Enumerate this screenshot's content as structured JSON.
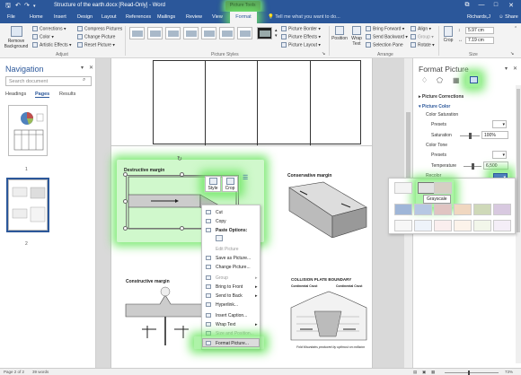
{
  "window": {
    "title": "Structure of the earth.docx [Read-Only] - Word",
    "context_group": "Picture Tools",
    "qa_icons": [
      "save-icon",
      "undo-icon",
      "redo-icon"
    ],
    "controls": [
      "restore-icon",
      "minimize-icon",
      "maximize-icon",
      "close-icon"
    ],
    "restore_glyph": "⧉",
    "min_glyph": "—",
    "max_glyph": "□",
    "close_glyph": "✕"
  },
  "tabs": [
    "File",
    "Home",
    "Insert",
    "Design",
    "Layout",
    "References",
    "Mailings",
    "Review",
    "View",
    "Format"
  ],
  "tell_me": "Tell me what you want to do...",
  "user": "Richards,J",
  "share": "Share",
  "ribbon": {
    "remove_background": "Remove Background",
    "corrections": "Corrections",
    "color": "Color",
    "artistic_effects": "Artistic Effects",
    "compress_pictures": "Compress Pictures",
    "change_picture": "Change Picture",
    "reset_picture": "Reset Picture",
    "group_adjust": "Adjust",
    "group_picture_styles": "Picture Styles",
    "picture_border": "Picture Border",
    "picture_effects": "Picture Effects",
    "picture_layout": "Picture Layout",
    "position": "Position",
    "wrap_text": "Wrap Text",
    "bring_forward": "Bring Forward",
    "send_backward": "Send Backward",
    "selection_pane": "Selection Pane",
    "align": "Align",
    "group": "Group",
    "rotate": "Rotate",
    "group_arrange": "Arrange",
    "crop": "Crop",
    "height": "5.97 cm",
    "width": "7.19 cm",
    "group_size": "Size"
  },
  "navigation": {
    "title": "Navigation",
    "search_placeholder": "Search document",
    "tabs": [
      "Headings",
      "Pages",
      "Results"
    ],
    "page_numbers": [
      "1",
      "2"
    ]
  },
  "document": {
    "labels": {
      "destructive": "Destructive margin",
      "conservative": "Conservative margin",
      "constructive": "Constructive margin",
      "collision": "COLLISION PLATE BOUNDARY",
      "continental_crust_left": "Continental Crust",
      "continental_crust_right": "Continental Crust",
      "fold_mountains": "Fold Mountains produced by upthrust on collision"
    },
    "minitoolbar": {
      "style": "Style",
      "crop": "Crop"
    }
  },
  "context_menu": {
    "items": [
      {
        "label": "Cut",
        "disabled": false
      },
      {
        "label": "Copy",
        "disabled": false
      },
      {
        "label": "Paste Options:",
        "disabled": false,
        "bold": true
      },
      {
        "label": "Edit Picture",
        "disabled": true
      },
      {
        "label": "Save as Picture...",
        "disabled": false
      },
      {
        "label": "Change Picture...",
        "disabled": false
      },
      {
        "label": "Group",
        "disabled": true
      },
      {
        "label": "Bring to Front",
        "disabled": false
      },
      {
        "label": "Send to Back",
        "disabled": false
      },
      {
        "label": "Hyperlink...",
        "disabled": false
      },
      {
        "label": "Insert Caption...",
        "disabled": false
      },
      {
        "label": "Wrap Text",
        "disabled": false
      },
      {
        "label": "Size and Position...",
        "disabled": true
      },
      {
        "label": "Format Picture...",
        "disabled": false
      }
    ]
  },
  "format_picture": {
    "title": "Format Picture",
    "picture_corrections": "Picture Corrections",
    "picture_color": "Picture Color",
    "color_saturation": "Color Saturation",
    "presets": "Presets",
    "saturation": "Saturation",
    "saturation_value": "100%",
    "color_tone": "Color Tone",
    "tone_presets": "Presets",
    "temperature": "Temperature",
    "temperature_value": "6,500",
    "recolor": "Recolor"
  },
  "recolor_tooltip": "Grayscale",
  "status": {
    "page": "Page 2 of 2",
    "words": "39 words",
    "zoom": "73%"
  },
  "colors": {
    "accent": "#2b579a",
    "highlight": "#78eb6e"
  }
}
